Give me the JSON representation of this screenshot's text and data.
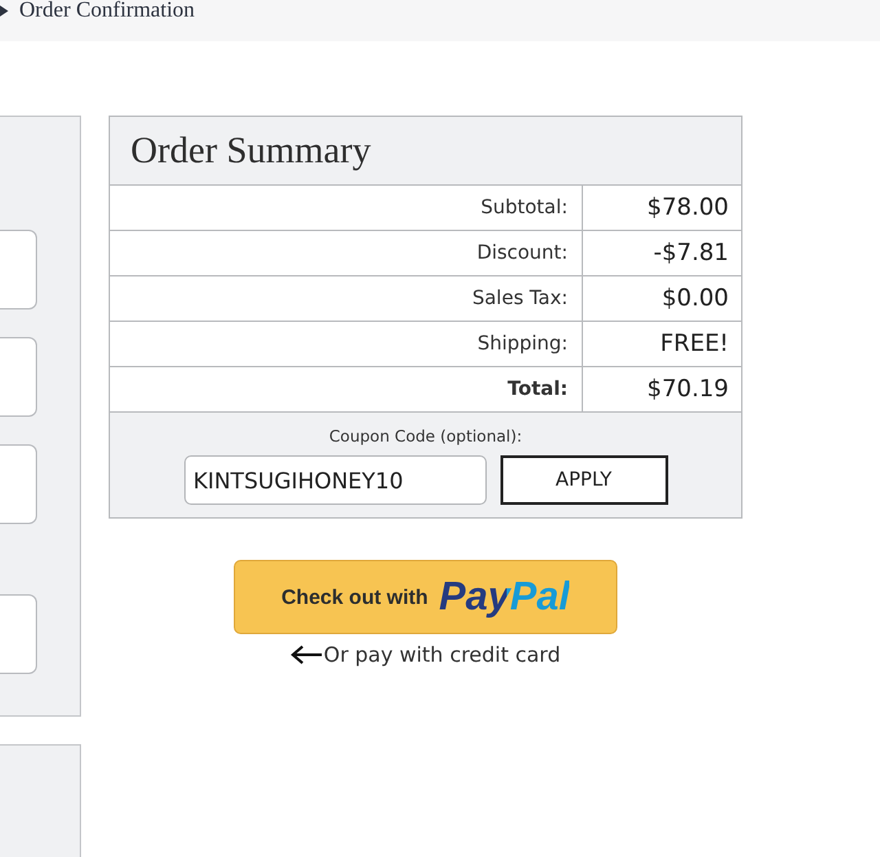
{
  "breadcrumb": {
    "label": "Order Confirmation"
  },
  "left_form": {
    "fields": [
      {
        "kind": "text"
      },
      {
        "kind": "text"
      },
      {
        "kind": "text"
      },
      {
        "kind": "text"
      }
    ]
  },
  "order_summary": {
    "title": "Order Summary",
    "rows": [
      {
        "label": "Subtotal:",
        "value": "$78.00",
        "kind": "normal"
      },
      {
        "label": "Discount:",
        "value": "-$7.81",
        "kind": "normal"
      },
      {
        "label": "Sales Tax:",
        "value": "$0.00",
        "kind": "normal"
      },
      {
        "label": "Shipping:",
        "value": "FREE!",
        "kind": "normal"
      },
      {
        "label": "Total:",
        "value": "$70.19",
        "kind": "total"
      }
    ],
    "coupon": {
      "label": "Coupon Code (optional):",
      "value": "KINTSUGIHONEY10",
      "button": "APPLY"
    }
  },
  "paypal_button": {
    "label": "Check out with",
    "logo": "PayPal"
  },
  "credit_card_link": "Or pay with credit card"
}
